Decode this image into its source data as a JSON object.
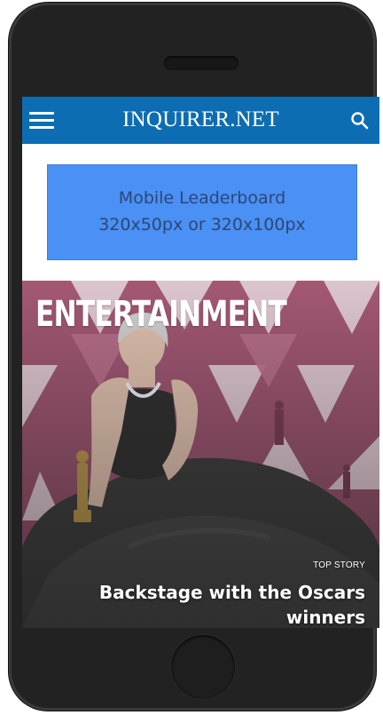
{
  "header": {
    "logo": "INQUIRER.NET",
    "menu_icon": "hamburger-menu-icon",
    "search_icon": "search-icon",
    "background_color": "#0d6db3"
  },
  "ad": {
    "line1": "Mobile Leaderboard",
    "line2": "320x50px or 320x100px",
    "background_color": "#4a90f5"
  },
  "top_story": {
    "section": "ENTERTAINMENT",
    "label": "TOP STORY",
    "headline": "Backstage with the Oscars winners"
  }
}
